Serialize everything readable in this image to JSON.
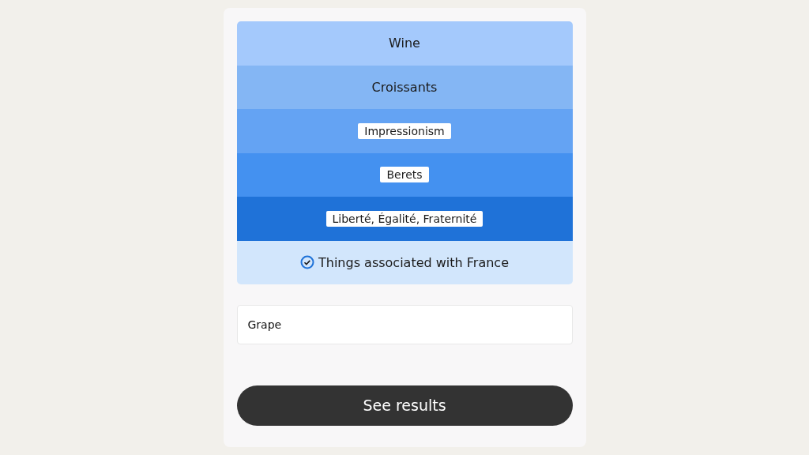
{
  "rows": [
    {
      "label": "Wine",
      "boxed": false,
      "color": "#a4c9fc"
    },
    {
      "label": "Croissants",
      "boxed": false,
      "color": "#84b6f4"
    },
    {
      "label": "Impressionism",
      "boxed": true,
      "color": "#64a3f3"
    },
    {
      "label": "Berets",
      "boxed": true,
      "color": "#4491f0"
    },
    {
      "label": "Liberté, Égalité, Fraternité",
      "boxed": true,
      "color": "#1f72d8"
    }
  ],
  "summary": {
    "label": "Things associated with France",
    "checked": true
  },
  "answer": {
    "value": "Grape"
  },
  "button": "See results"
}
